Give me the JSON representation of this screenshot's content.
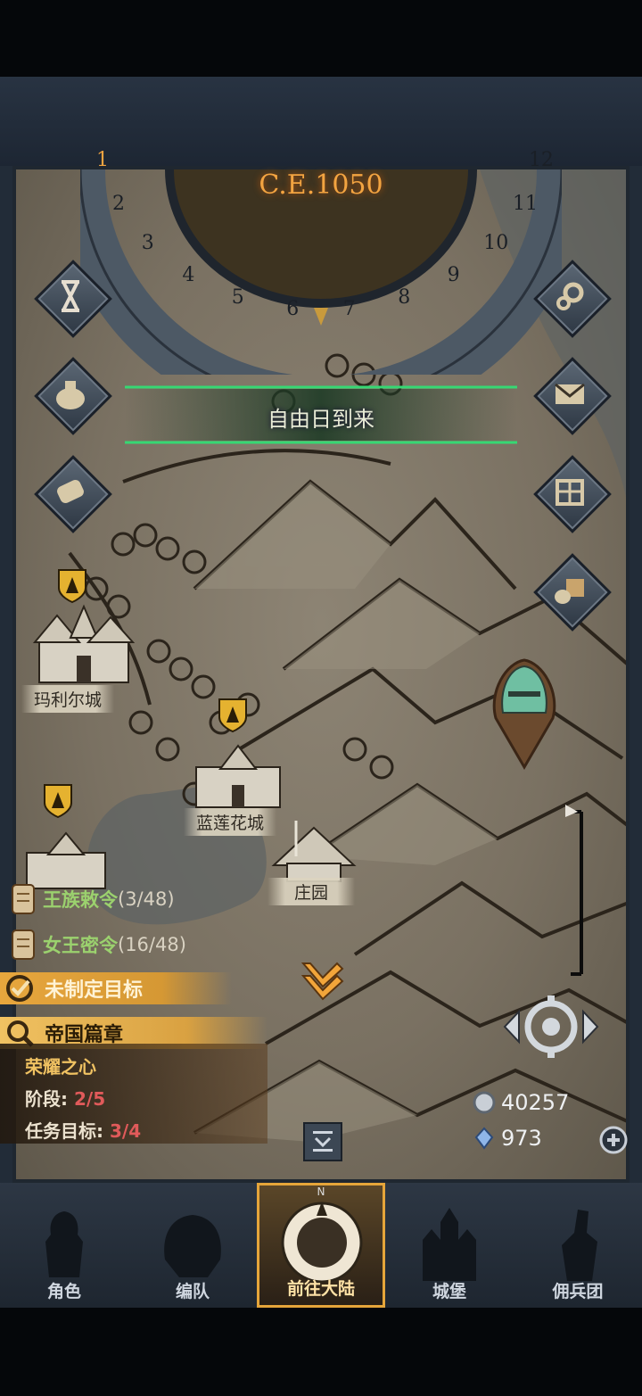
{
  "calendar": {
    "year": "C.E.1050",
    "months": [
      "1",
      "2",
      "3",
      "4",
      "5",
      "6",
      "7",
      "8",
      "9",
      "10",
      "11",
      "12"
    ]
  },
  "event_banner": "自由日到来",
  "side_buttons_left": [
    "hourglass-icon",
    "money-bag-icon",
    "scroll-icon"
  ],
  "side_buttons_right": [
    "gear-icon",
    "mail-icon",
    "building-icon",
    "goods-icon"
  ],
  "cities": {
    "marier": "玛利尔城",
    "lotus": "蓝莲花城",
    "manor": "庄园"
  },
  "quests": [
    {
      "name": "王族敕令",
      "progress": "(3/48)"
    },
    {
      "name": "女王密令",
      "progress": "(16/48)"
    }
  ],
  "goal_bar": "未制定目标",
  "chapter": {
    "header": "帝国篇章",
    "title": "荣耀之心",
    "stage_label": "阶段",
    "stage_value": "2/5",
    "target_label": "任务目标",
    "target_value": "3/4"
  },
  "resources": {
    "silver": "40257",
    "crystal": "973"
  },
  "nav": {
    "items": [
      "角色",
      "编队",
      "前往大陆",
      "城堡",
      "佣兵团"
    ],
    "active": "前往大陆",
    "compass_letter": "N"
  },
  "colors": {
    "accent_gold": "#e5a53a",
    "quest_green": "#9bd16e",
    "progress_red": "#e05a5a",
    "banner_glow": "#36d873"
  }
}
